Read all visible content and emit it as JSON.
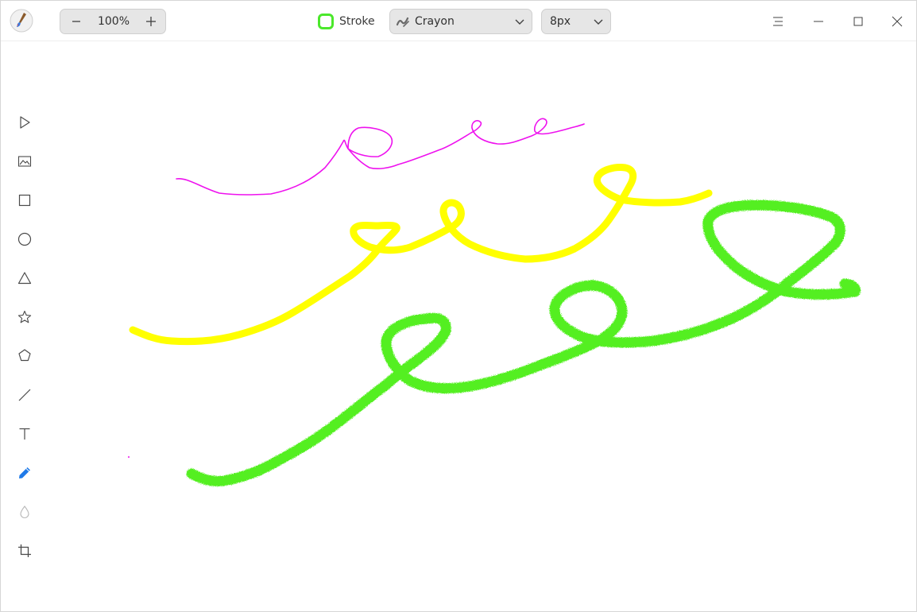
{
  "app": {
    "icon": "brush-app-icon"
  },
  "zoom": {
    "value": "100%",
    "decrease_icon": "minus-icon",
    "increase_icon": "plus-icon"
  },
  "stroke": {
    "label": "Stroke",
    "color": "#4be82b"
  },
  "brush": {
    "selected": "Crayon",
    "icon": "crayon-icon"
  },
  "size": {
    "selected": "8px"
  },
  "window_controls": {
    "menu_icon": "hamburger-icon",
    "minimize_icon": "minimize-icon",
    "maximize_icon": "maximize-icon",
    "close_icon": "close-icon"
  },
  "tools": [
    {
      "name": "select",
      "icon": "cursor-icon",
      "active": false
    },
    {
      "name": "image",
      "icon": "image-icon",
      "active": false
    },
    {
      "name": "rectangle",
      "icon": "square-icon",
      "active": false
    },
    {
      "name": "ellipse",
      "icon": "circle-icon",
      "active": false
    },
    {
      "name": "triangle",
      "icon": "triangle-icon",
      "active": false
    },
    {
      "name": "star",
      "icon": "star-icon",
      "active": false
    },
    {
      "name": "polygon",
      "icon": "pentagon-icon",
      "active": false
    },
    {
      "name": "line",
      "icon": "line-icon",
      "active": false
    },
    {
      "name": "text",
      "icon": "text-icon",
      "active": false
    },
    {
      "name": "pen",
      "icon": "pencil-icon",
      "active": true
    },
    {
      "name": "blur",
      "icon": "droplet-icon",
      "active": false
    },
    {
      "name": "crop",
      "icon": "crop-icon",
      "active": false
    }
  ],
  "colors": {
    "magenta_stroke": "#ee11ee",
    "yellow_stroke": "#ffff00",
    "green_stroke": "#44ee11",
    "active_tool": "#1f7ae8",
    "icon": "#4a4a4a"
  }
}
